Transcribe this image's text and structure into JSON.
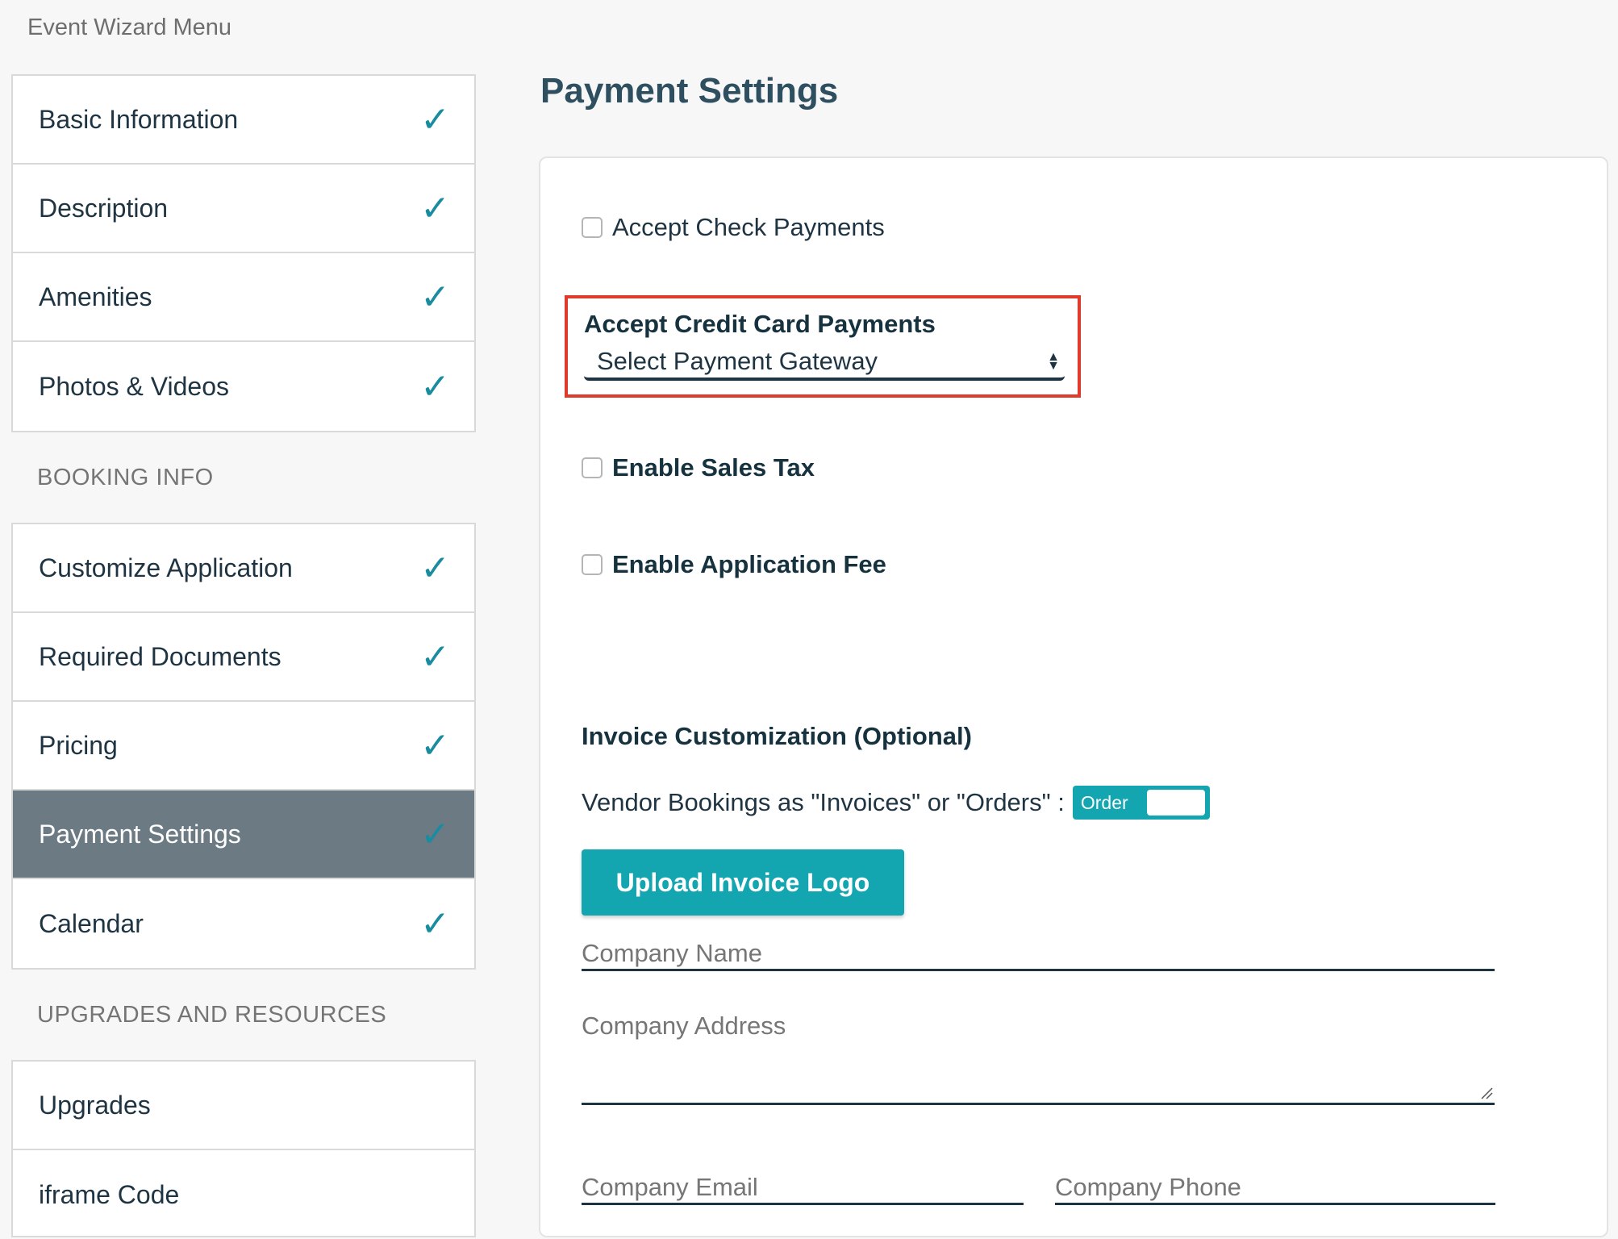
{
  "sidebar": {
    "menu_title": "Event Wizard Menu",
    "groups": [
      {
        "items": [
          {
            "label": "Basic Information",
            "check": "✓"
          },
          {
            "label": "Description",
            "check": "✓"
          },
          {
            "label": "Amenities",
            "check": "✓"
          },
          {
            "label": "Photos & Videos",
            "check": "✓"
          }
        ]
      },
      {
        "section": "BOOKING INFO",
        "items": [
          {
            "label": "Customize Application",
            "check": "✓"
          },
          {
            "label": "Required Documents",
            "check": "✓"
          },
          {
            "label": "Pricing",
            "check": "✓"
          },
          {
            "label": "Payment Settings",
            "check": "✓",
            "active": true
          },
          {
            "label": "Calendar",
            "check": "✓"
          }
        ]
      },
      {
        "section": "UPGRADES AND RESOURCES",
        "items": [
          {
            "label": "Upgrades"
          },
          {
            "label": "iframe Code"
          }
        ]
      }
    ]
  },
  "main": {
    "title": "Payment Settings",
    "accept_check": {
      "label": "Accept Check Payments",
      "checked": false
    },
    "credit_card": {
      "title": "Accept Credit Card Payments",
      "select_value": "Select Payment Gateway"
    },
    "sales_tax": {
      "label": "Enable Sales Tax",
      "checked": false
    },
    "application_fee": {
      "label": "Enable Application Fee",
      "checked": false
    },
    "invoice": {
      "title": "Invoice Customization (Optional)",
      "vendor_label": "Vendor Bookings as \"Invoices\" or \"Orders\" :",
      "toggle_label": "Order",
      "upload_button": "Upload Invoice Logo",
      "company_name_label": "Company Name",
      "company_address_label": "Company Address",
      "company_email_label": "Company Email",
      "company_phone_label": "Company Phone"
    }
  },
  "colors": {
    "accent": "#13a6b1",
    "active_item_bg": "#6c7a84",
    "highlight_box": "#e03a2d",
    "checkmark": "#1a8c9f"
  }
}
